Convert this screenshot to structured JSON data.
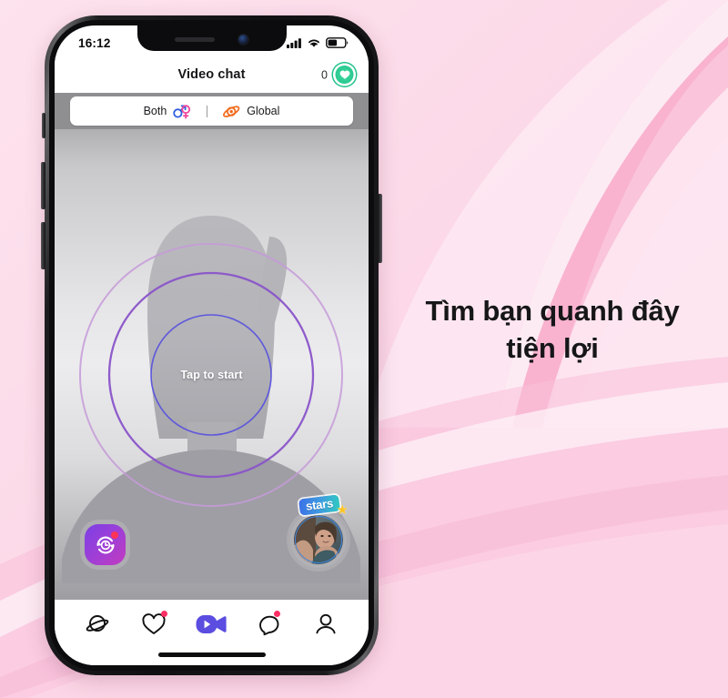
{
  "promo": {
    "headline": "Tìm bạn quanh đây\ntiện lợi",
    "background_color": "#fbd3e4",
    "headline_color": "#161618"
  },
  "phone": {
    "status_bar": {
      "time": "16:12",
      "signal_icon": "cellular-signal-icon",
      "wifi_icon": "wifi-icon",
      "battery_icon": "battery-icon"
    },
    "app_header": {
      "title": "Video chat",
      "coin_count": "0",
      "coin_icon": "heart-badge-icon"
    },
    "filter_bar": {
      "gender_label": "Both",
      "gender_icon": "gender-both-icon",
      "region_label": "Global",
      "region_icon": "globe-atom-icon"
    },
    "video_stage": {
      "tap_label": "Tap to start",
      "history_button_icon": "history-rotate-icon",
      "history_button_badge": true,
      "avatar": {
        "badge_label": "stars",
        "star_icon": "star-icon",
        "ring_color": "#3f86e0"
      },
      "ring_colors": {
        "outer": "#c59ad8",
        "middle": "#8a54c9",
        "inner": "#5a52dd"
      }
    },
    "bottom_nav": {
      "items": [
        {
          "name": "discover",
          "icon": "planet-icon",
          "active": false,
          "badge": false
        },
        {
          "name": "likes",
          "icon": "heart-icon",
          "active": false,
          "badge": true
        },
        {
          "name": "video-chat",
          "icon": "video-camera-icon",
          "active": true,
          "badge": false
        },
        {
          "name": "messages",
          "icon": "chat-bubble-icon",
          "active": false,
          "badge": true
        },
        {
          "name": "profile",
          "icon": "person-icon",
          "active": false,
          "badge": false
        }
      ],
      "active_color": "#5b4de0"
    }
  }
}
